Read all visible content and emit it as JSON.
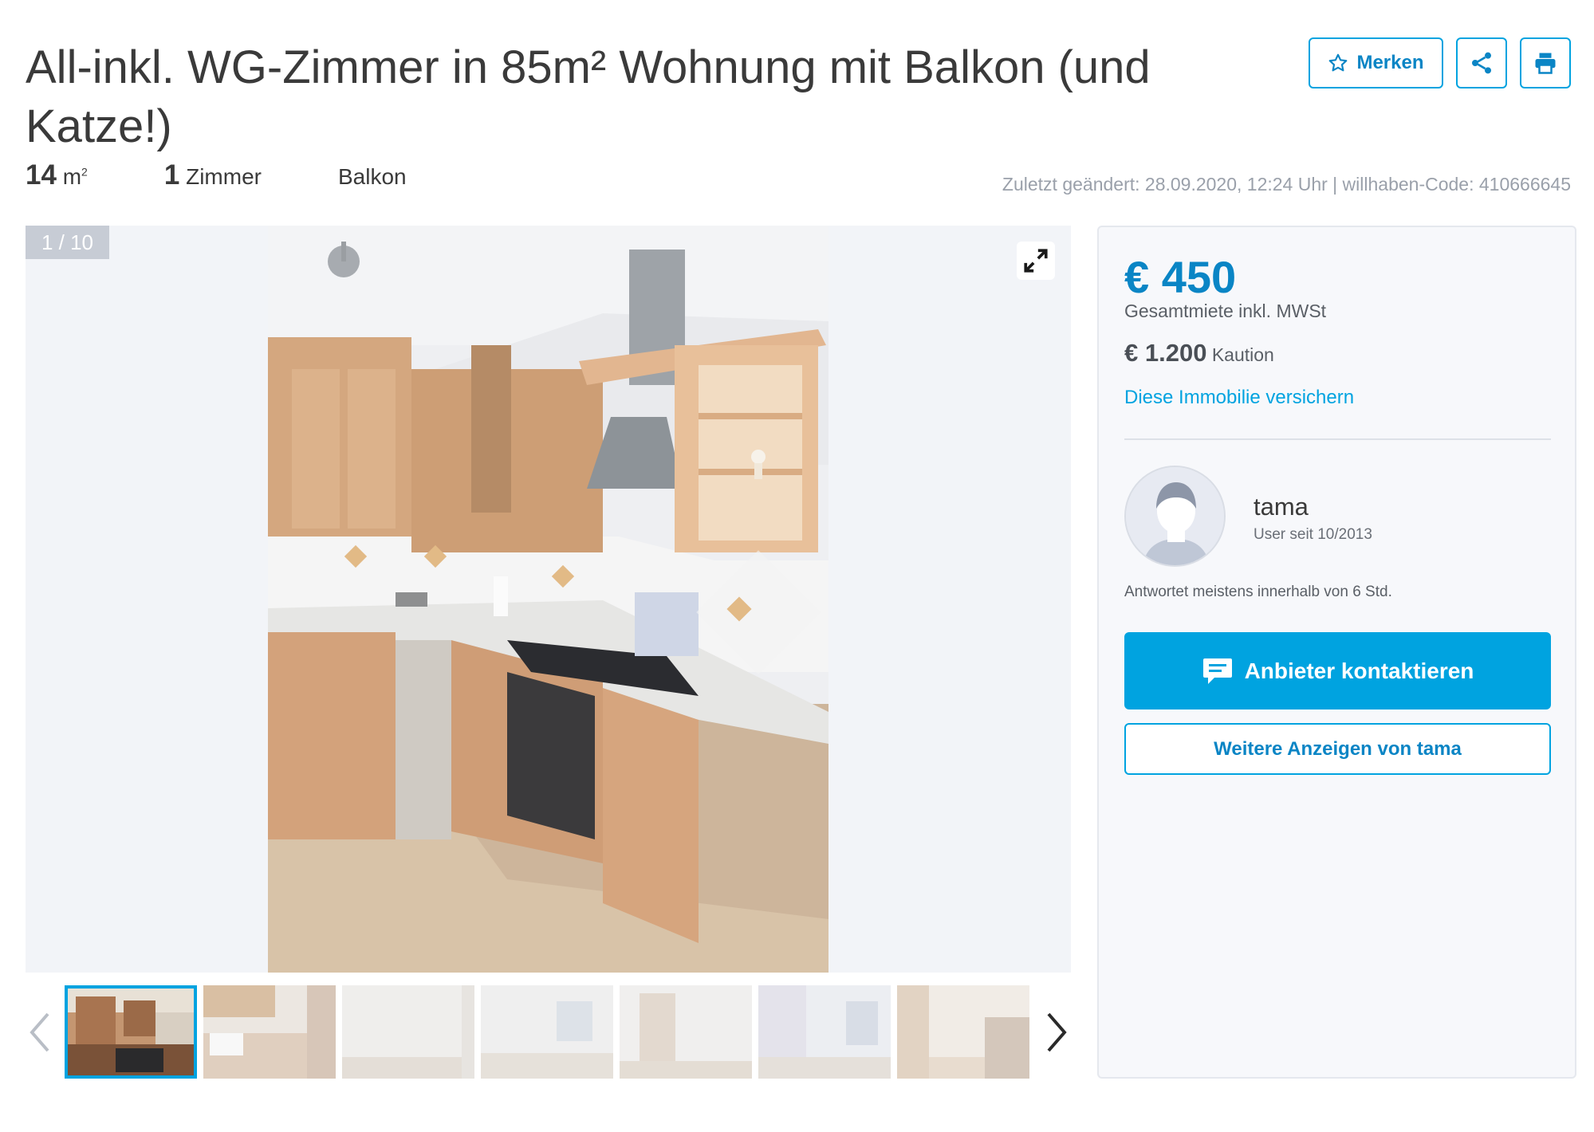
{
  "listing": {
    "title": "All-inkl. WG-Zimmer in 85m² Wohnung mit Balkon (und Katze!)",
    "actions": {
      "bookmark_label": "Merken",
      "share_icon": "share-icon",
      "print_icon": "print-icon"
    },
    "facts": {
      "area_value": "14",
      "area_unit": "m",
      "area_sup": "2",
      "rooms_value": "1",
      "rooms_label": "Zimmer",
      "feature": "Balkon"
    },
    "meta": "Zuletzt geändert: 28.09.2020, 12:24 Uhr | willhaben-Code: 410666645"
  },
  "gallery": {
    "counter": "1 / 10",
    "thumbnail_count": 7,
    "active_thumbnail": 1
  },
  "sidebar": {
    "price": "€ 450",
    "price_label": "Gesamtmiete inkl. MWSt",
    "deposit_value": "€ 1.200",
    "deposit_label": "Kaution",
    "insure_link": "Diese Immobilie versichern",
    "seller": {
      "name": "tama",
      "since": "User seit 10/2013",
      "response": "Antwortet meistens innerhalb von 6 Std."
    },
    "contact_button": "Anbieter kontaktieren",
    "more_ads_button": "Weitere Anzeigen von tama"
  },
  "colors": {
    "accent": "#00a3e0",
    "accent_dark": "#0a85c5",
    "muted": "#9aa0aa"
  }
}
